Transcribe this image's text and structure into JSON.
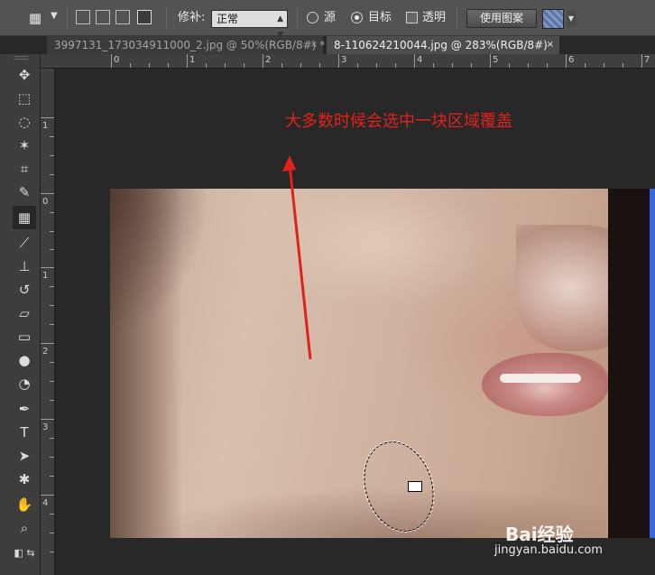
{
  "options_bar": {
    "tool_icon": "patch-tool-icon",
    "patch_label": "修补:",
    "patch_mode_value": "正常",
    "source_label": "源",
    "destination_label": "目标",
    "transparent_label": "透明",
    "use_pattern_label": "使用图案",
    "source_checked": false,
    "destination_checked": true,
    "transparent_checked": false
  },
  "tabs": [
    {
      "label": "3997131_173034911000_2.jpg @ 50%(RGB/8#) *",
      "active": false
    },
    {
      "label": "8-110624210044.jpg @ 283%(RGB/8#)",
      "active": true
    }
  ],
  "tab_close_glyph": "×",
  "toolbox": {
    "tools": [
      "move-tool-icon",
      "marquee-tool-icon",
      "lasso-tool-icon",
      "quick-selection-tool-icon",
      "crop-tool-icon",
      "eyedropper-tool-icon",
      "patch-tool-icon",
      "brush-tool-icon",
      "clone-stamp-tool-icon",
      "history-brush-tool-icon",
      "eraser-tool-icon",
      "gradient-tool-icon",
      "blur-tool-icon",
      "dodge-tool-icon",
      "pen-tool-icon",
      "type-tool-icon",
      "path-selection-tool-icon",
      "custom-shape-tool-icon",
      "hand-tool-icon",
      "zoom-tool-icon"
    ],
    "active_tool": "patch-tool-icon"
  },
  "rulers": {
    "top_labels": [
      "0",
      "1",
      "2",
      "3",
      "4",
      "5",
      "6",
      "7"
    ],
    "left_labels": [
      "1",
      "0",
      "1",
      "2",
      "3",
      "4"
    ]
  },
  "annotation": {
    "text": "大多数时候会选中一块区域覆盖",
    "color": "#e0221b"
  },
  "watermark": {
    "brand": "Bai经验",
    "url": "jingyan.baidu.com"
  }
}
